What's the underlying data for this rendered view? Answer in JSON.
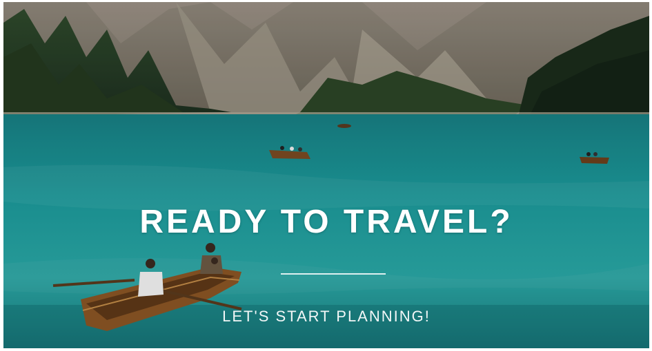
{
  "hero": {
    "title": "READY TO TRAVEL?",
    "subtitle": "LET'S START PLANNING!",
    "background_image": "lake-with-rowboats-and-mountains",
    "colors": {
      "lake": "#1f9ea0",
      "text": "#ffffff"
    }
  }
}
